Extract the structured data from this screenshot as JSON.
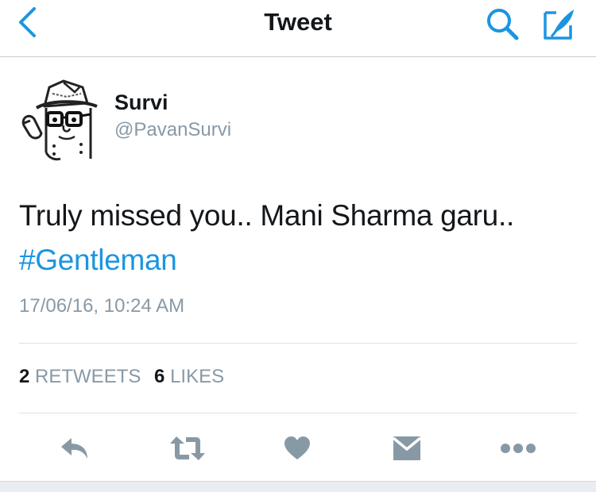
{
  "nav": {
    "title": "Tweet",
    "back_icon": "chevron-left-icon",
    "search_icon": "search-icon",
    "compose_icon": "compose-quill-icon",
    "accent_color": "#1b95e0"
  },
  "author": {
    "name": "Survi",
    "handle": "@PavanSurvi",
    "avatar_icon": "cartoon-avatar"
  },
  "tweet": {
    "text": "Truly missed you.. Mani Sharma garu..",
    "hashtag": "#Gentleman",
    "timestamp": "17/06/16, 10:24 AM",
    "hashtag_color": "#1b95e0"
  },
  "stats": {
    "retweets_count": "2",
    "retweets_label": "RETWEETS",
    "likes_count": "6",
    "likes_label": "LIKES"
  },
  "actions": {
    "reply_icon": "reply-icon",
    "retweet_icon": "retweet-icon",
    "like_icon": "heart-icon",
    "dm_icon": "envelope-icon",
    "more_icon": "more-icon",
    "icon_color": "#8899a6"
  }
}
